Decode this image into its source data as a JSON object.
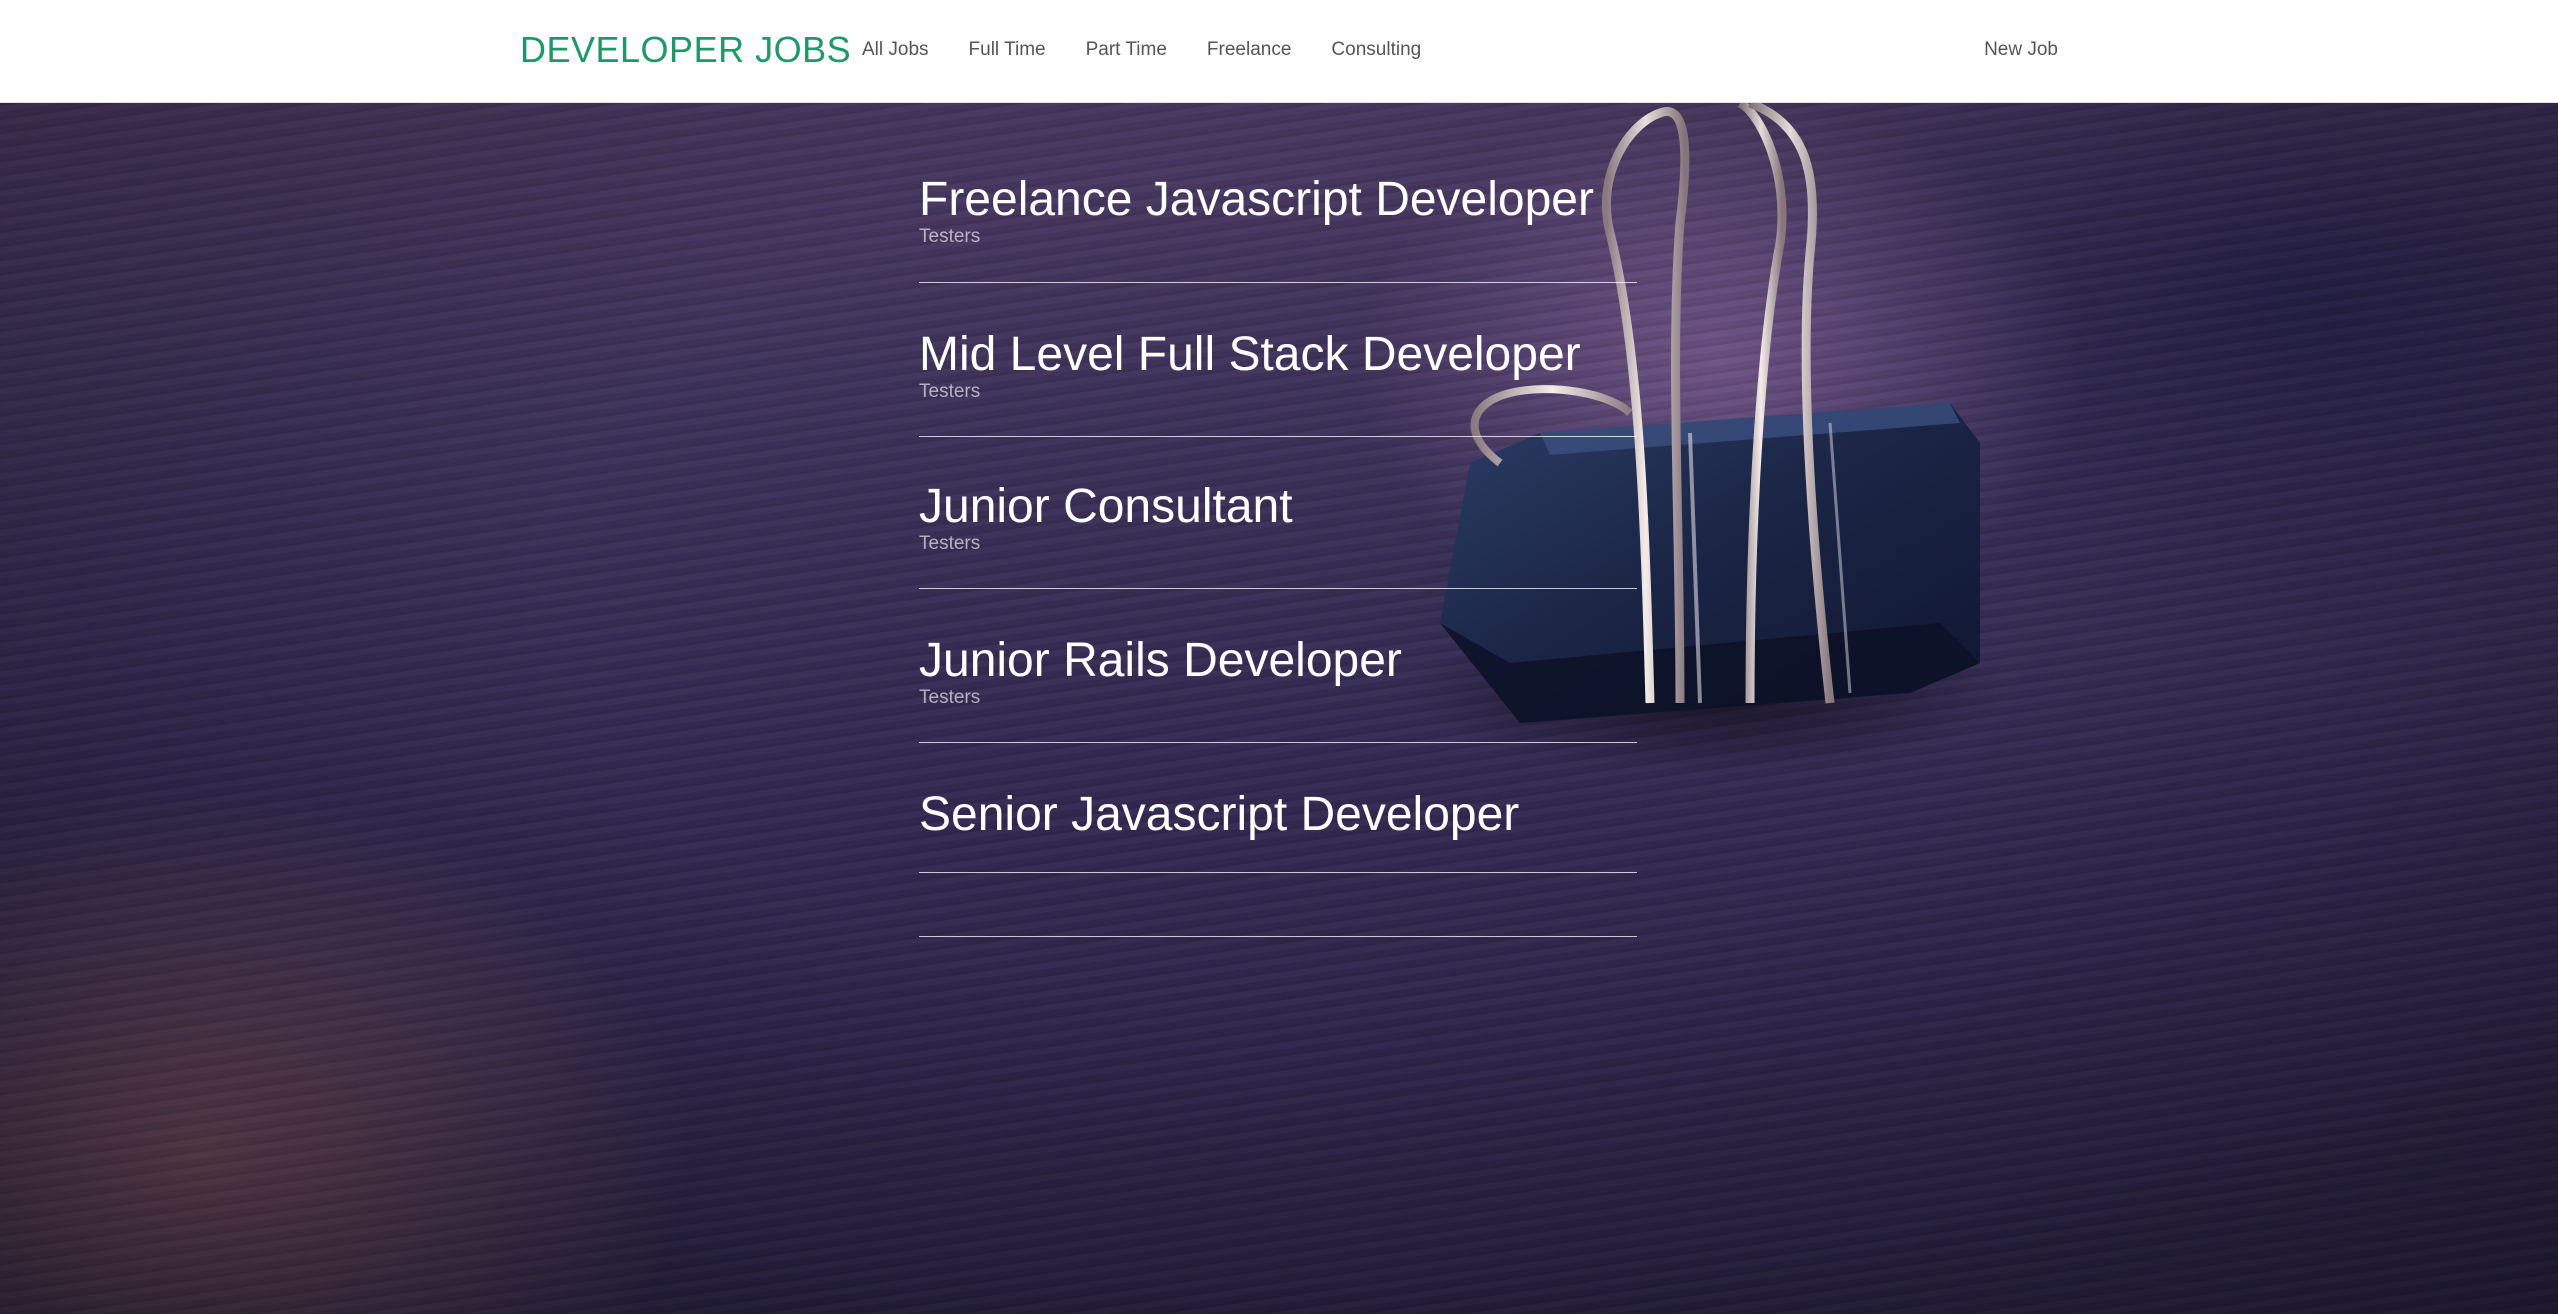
{
  "brand": "DEVELOPER JOBS",
  "nav": {
    "links": [
      "All Jobs",
      "Full Time",
      "Part Time",
      "Freelance",
      "Consulting"
    ],
    "new_job": "New Job"
  },
  "jobs": [
    {
      "title": "Freelance Javascript Developer",
      "company": "Testers"
    },
    {
      "title": "Mid Level Full Stack Developer",
      "company": "Testers"
    },
    {
      "title": "Junior Consultant",
      "company": "Testers"
    },
    {
      "title": "Junior Rails Developer",
      "company": "Testers"
    },
    {
      "title": "Senior Javascript Developer",
      "company": ""
    },
    {
      "title": "",
      "company": ""
    }
  ],
  "colors": {
    "brand": "#1c9a66",
    "nav_text": "#555555",
    "job_title": "#ffffff"
  },
  "background_image": "binder-clip-on-wood-desk"
}
